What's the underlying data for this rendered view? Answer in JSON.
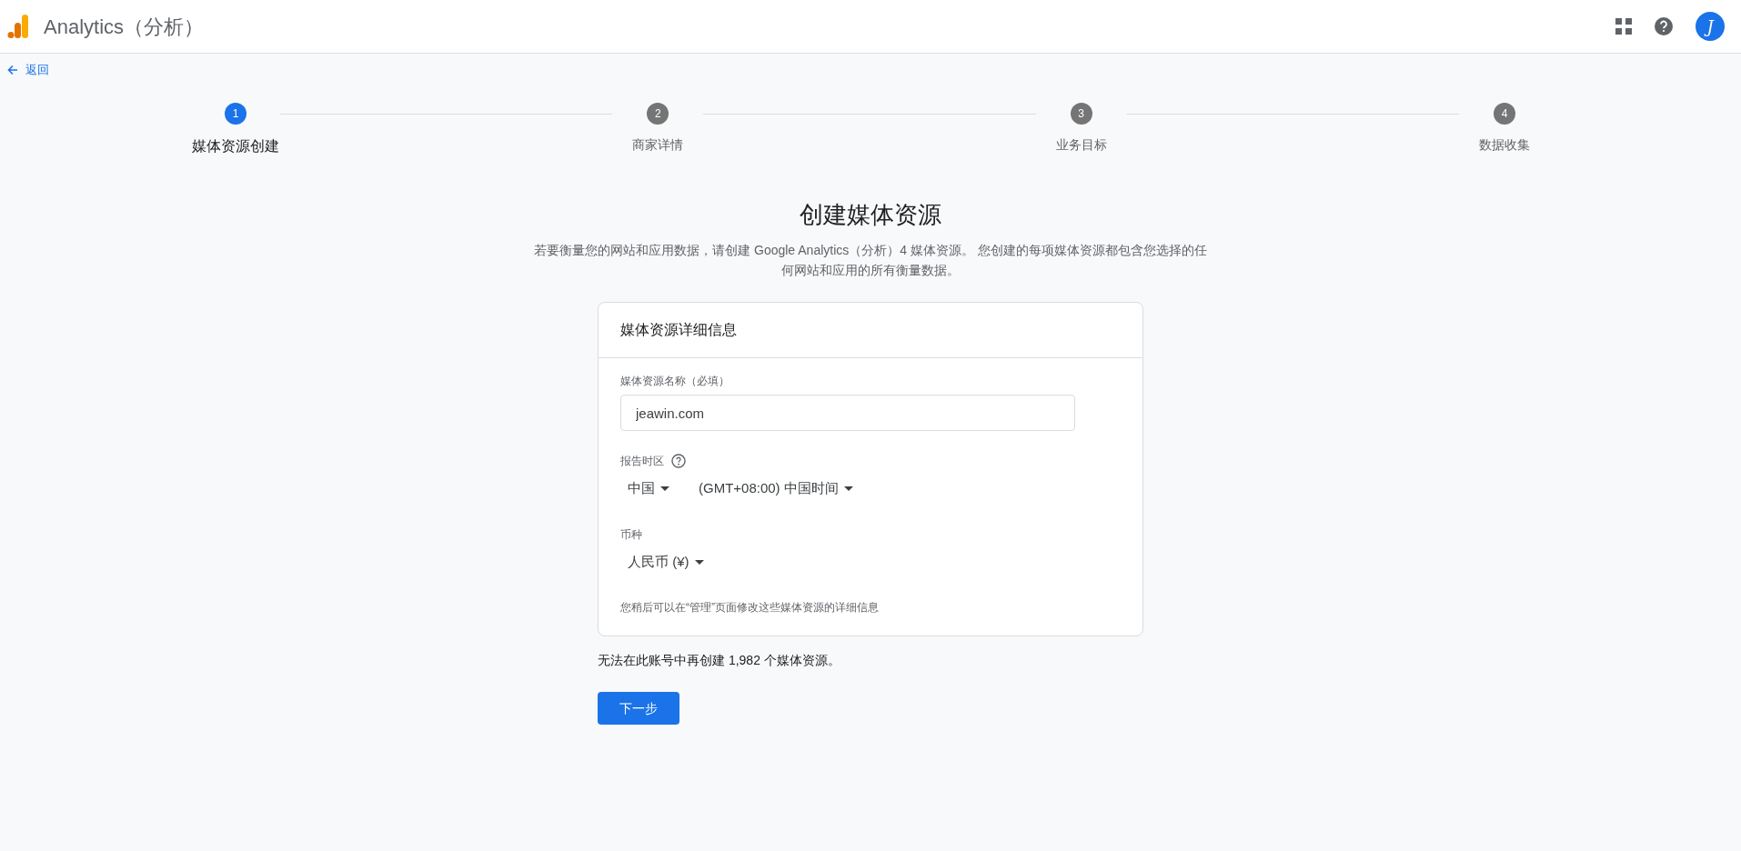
{
  "app_bar": {
    "title": "Analytics（分析）",
    "avatar_letter": "J"
  },
  "back_link": "返回",
  "steps": [
    {
      "number": "1",
      "label": "媒体资源创建",
      "current": true
    },
    {
      "number": "2",
      "label": "商家详情",
      "current": false
    },
    {
      "number": "3",
      "label": "业务目标",
      "current": false
    },
    {
      "number": "4",
      "label": "数据收集",
      "current": false
    }
  ],
  "heading": "创建媒体资源",
  "description": "若要衡量您的网站和应用数据，请创建 Google Analytics（分析）4 媒体资源。 您创建的每项媒体资源都包含您选择的任何网站和应用的所有衡量数据。",
  "card": {
    "title": "媒体资源详细信息",
    "name_field": {
      "label": "媒体资源名称（必填）",
      "value": "jeawin.com"
    },
    "timezone": {
      "label": "报告时区",
      "country": "中国",
      "zone": "(GMT+08:00) 中国时间"
    },
    "currency": {
      "label": "币种",
      "value": "人民币 (¥)"
    },
    "note": "您稍后可以在“管理”页面修改这些媒体资源的详细信息"
  },
  "limit_text": "无法在此账号中再创建 1,982 个媒体资源。",
  "next_button": "下一步"
}
